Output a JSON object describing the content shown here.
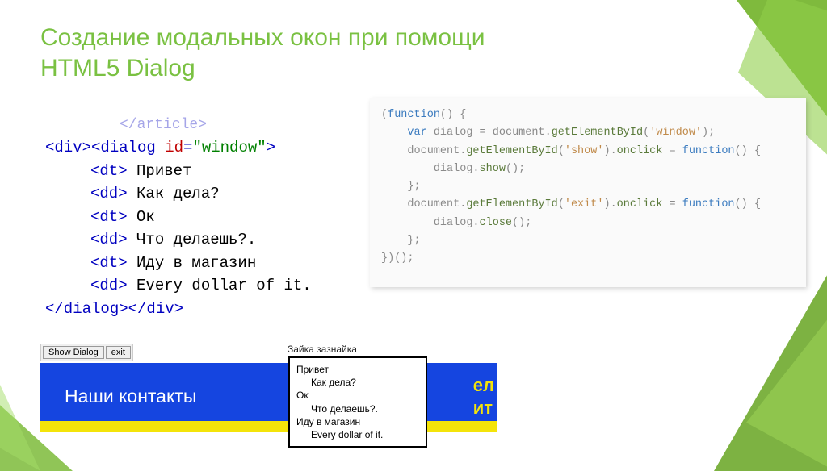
{
  "title": "Создание модальных окон при помощи HTML5 Dialog",
  "html_code": {
    "faded": "</article>",
    "lines": [
      {
        "pre": "<div><dialog ",
        "attr": "id",
        "val": "\"window\"",
        "post": ">"
      },
      {
        "ind": true,
        "tag": "<dt>",
        "text": " Привет"
      },
      {
        "ind": true,
        "tag": "<dd>",
        "text": " Как дела?"
      },
      {
        "ind": true,
        "tag": "<dt>",
        "text": " Ок"
      },
      {
        "ind": true,
        "tag": "<dd>",
        "text": " Что делаешь?."
      },
      {
        "ind": true,
        "tag": "<dt>",
        "text": " Иду в магазин"
      },
      {
        "ind": true,
        "tag": "<dd>",
        "text": " Every dollar of it."
      },
      {
        "closing": "</dialog></div>"
      }
    ]
  },
  "js_code": [
    "(function() {",
    "    var dialog = document.getElementById('window');",
    "    document.getElementById('show').onclick = function() {",
    "        dialog.show();",
    "    };",
    "    document.getElementById('exit').onclick = function() {",
    "        dialog.close();",
    "    };",
    "})();"
  ],
  "mock": {
    "btn_show": "Show Dialog",
    "btn_exit": "exit",
    "caption": "Зайка зазнайка",
    "heading": "Наши контакты",
    "trunc1": "ел",
    "trunc2": "ит",
    "popup": {
      "dt1": "Привет",
      "dd1": "Как дела?",
      "dt2": "Ок",
      "dd2": "Что делаешь?.",
      "dt3": "Иду в магазин",
      "dd3": "Every dollar of it."
    }
  }
}
